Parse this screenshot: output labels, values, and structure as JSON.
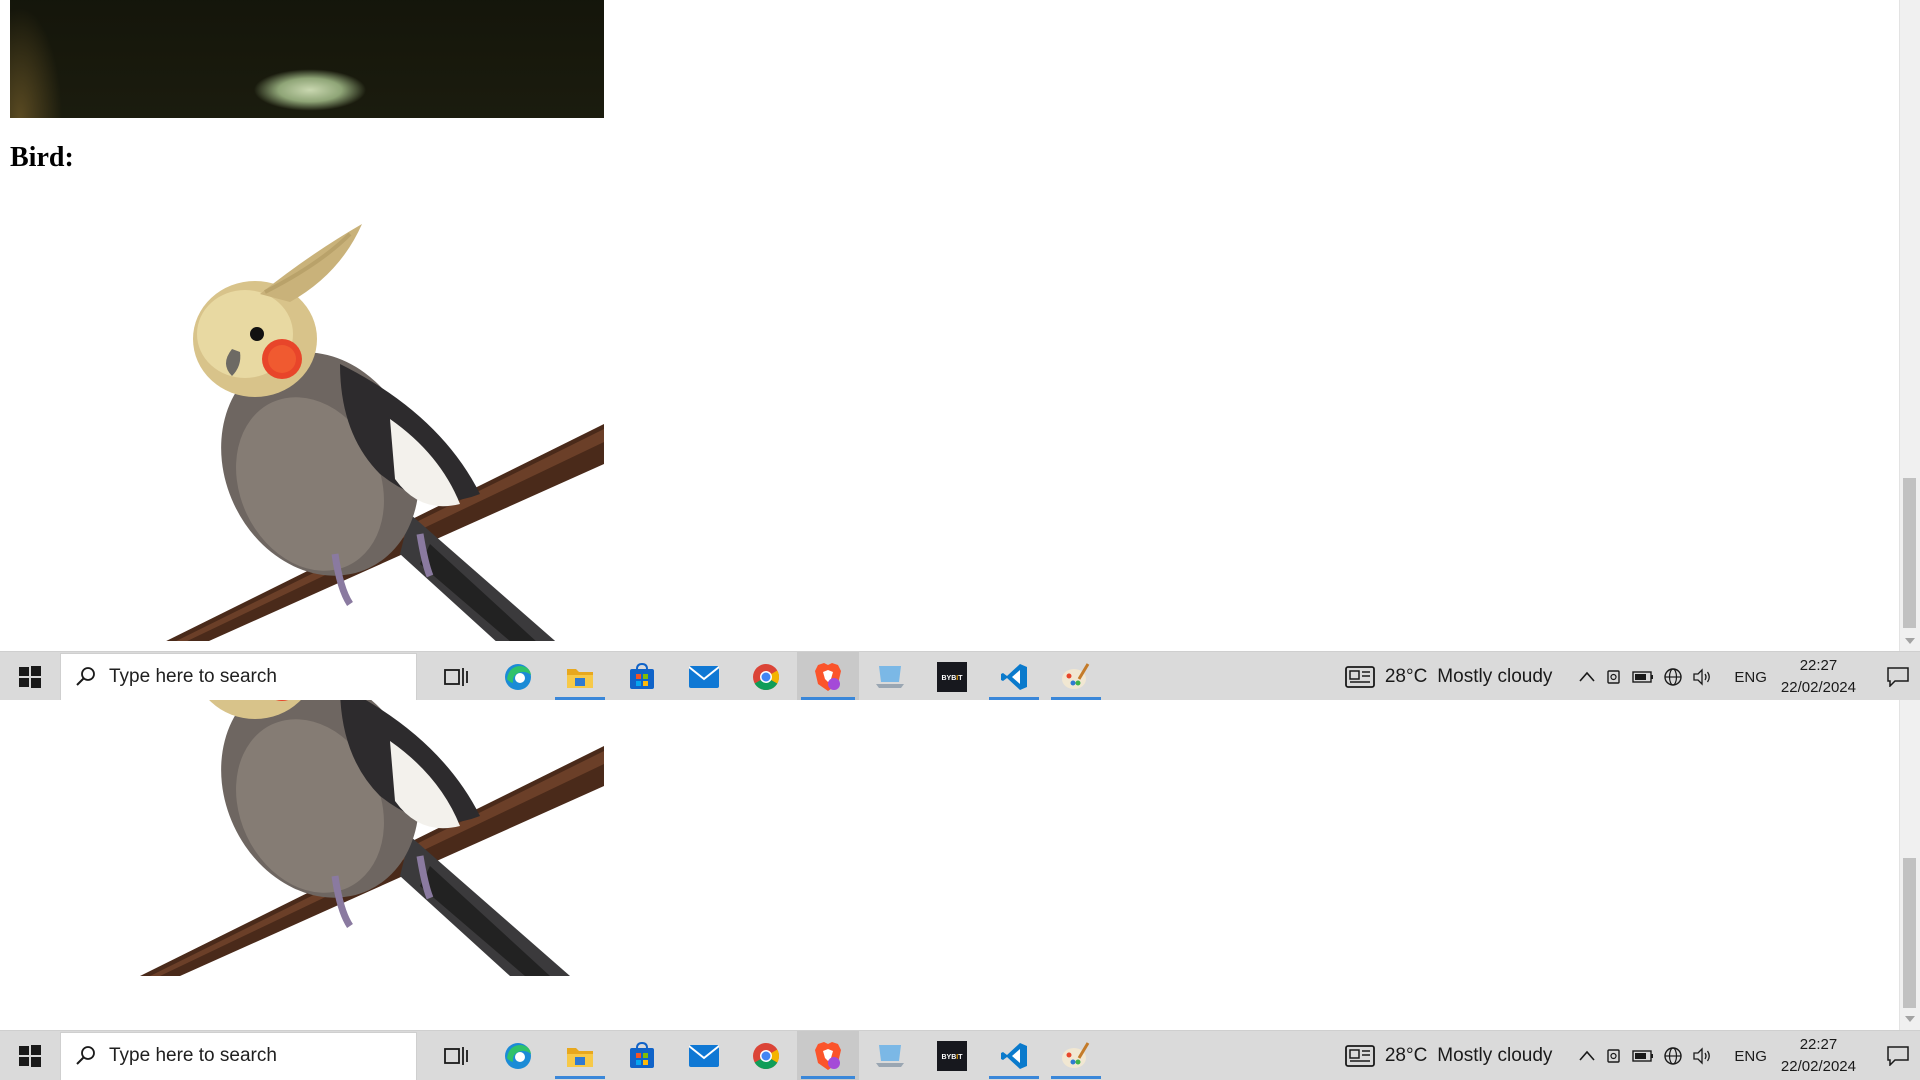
{
  "page": {
    "heading_bird": "Bird:"
  },
  "taskbar": {
    "search_placeholder": "Type here to search",
    "apps": [
      {
        "name": "Task View",
        "icon": "task-view-icon",
        "running": false
      },
      {
        "name": "Microsoft Edge",
        "icon": "edge-icon",
        "running": false
      },
      {
        "name": "File Explorer",
        "icon": "file-explorer-icon",
        "running": true
      },
      {
        "name": "Microsoft Store",
        "icon": "store-icon",
        "running": false
      },
      {
        "name": "Mail",
        "icon": "mail-icon",
        "running": false
      },
      {
        "name": "Google Chrome",
        "icon": "chrome-icon",
        "running": false
      },
      {
        "name": "Brave Browser",
        "icon": "brave-icon",
        "running": true,
        "active": true
      },
      {
        "name": "Remote Desktop",
        "icon": "remote-desktop-icon",
        "running": false
      },
      {
        "name": "Bybit",
        "icon": "bybit-icon",
        "label": "BYBIT",
        "running": false
      },
      {
        "name": "Visual Studio Code",
        "icon": "vscode-icon",
        "running": true
      },
      {
        "name": "Paint",
        "icon": "paint-icon",
        "running": true
      }
    ],
    "weather": {
      "temperature": "28°C",
      "condition": "Mostly cloudy"
    },
    "language": "ENG",
    "time": "22:27",
    "date": "22/02/2024"
  },
  "colors": {
    "taskbar_bg": "#dadada",
    "running_indicator": "#3a87d9",
    "vscode_blue": "#0a7acc",
    "bybit_bg": "#17181e"
  }
}
